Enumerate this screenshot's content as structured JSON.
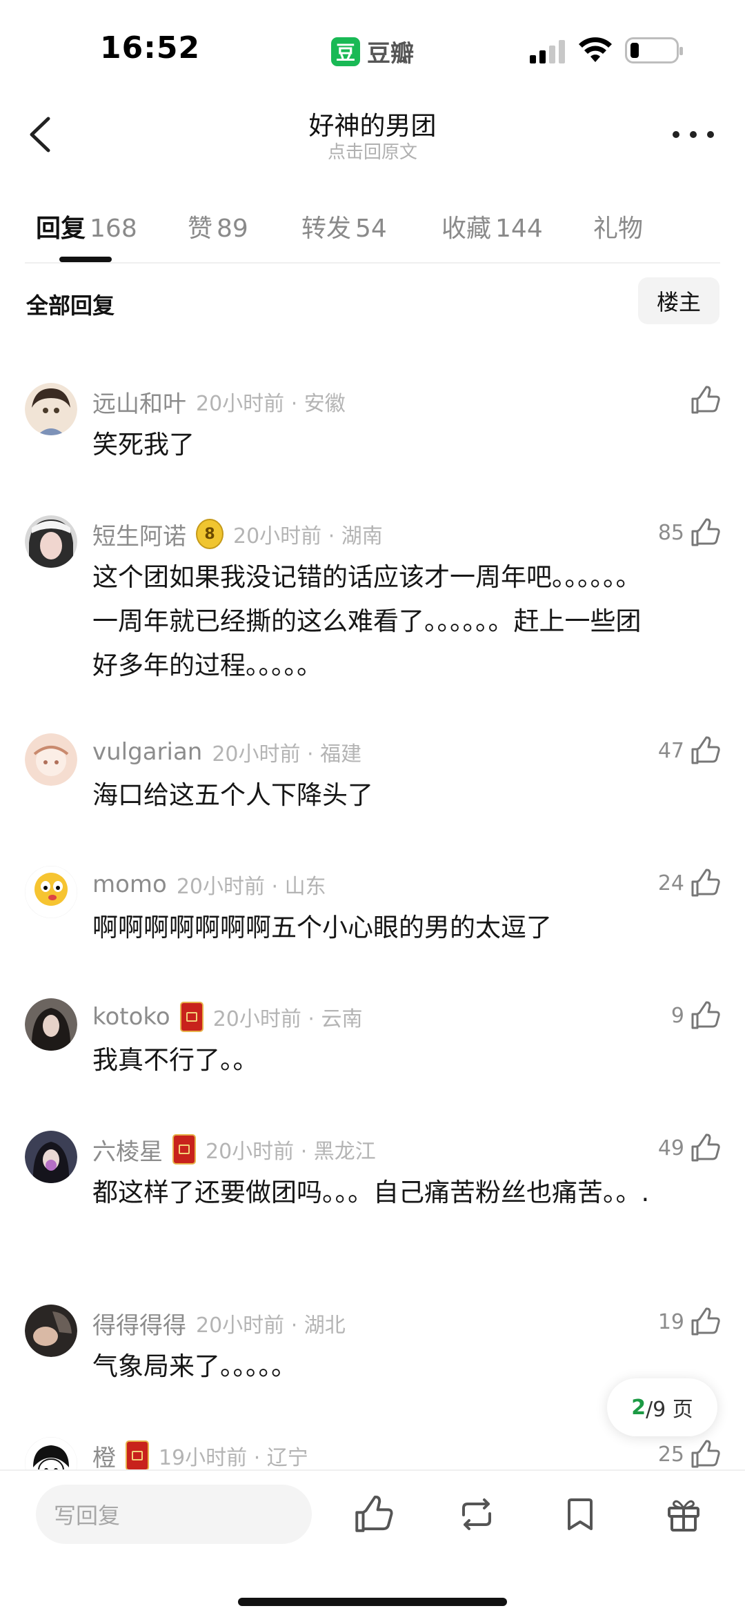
{
  "status_bar": {
    "time": "16:52",
    "app_badge": "豆",
    "app_name": "豆瓣"
  },
  "nav": {
    "title": "好神的男团",
    "subtitle": "点击回原文"
  },
  "tabs": [
    {
      "label": "回复",
      "count": "168"
    },
    {
      "label": "赞",
      "count": "89"
    },
    {
      "label": "转发",
      "count": "54"
    },
    {
      "label": "收藏",
      "count": "144"
    },
    {
      "label": "礼物",
      "count": ""
    }
  ],
  "filter": {
    "label": "全部回复",
    "owner_button": "楼主"
  },
  "comments": [
    {
      "name": "远山和叶",
      "badge": "",
      "meta": "20小时前 · 安徽",
      "body": "笑死我了",
      "likes": ""
    },
    {
      "name": "短生阿诺",
      "badge": "8",
      "meta": "20小时前 · 湖南",
      "body": "这个团如果我没记错的话应该才一周年吧。。。。。。一周年就已经撕的这么难看了。。。。。。赶上一些团好多年的过程。。。。。",
      "likes": "85"
    },
    {
      "name": "vulgarian",
      "badge": "",
      "meta": "20小时前 · 福建",
      "body": "海口给这五个人下降头了",
      "likes": "47"
    },
    {
      "name": "momo",
      "badge": "",
      "meta": "20小时前 · 山东",
      "body": "啊啊啊啊啊啊啊五个小心眼的男的太逗了",
      "likes": "24"
    },
    {
      "name": "kotoko",
      "badge": "red",
      "meta": "20小时前 · 云南",
      "body": "我真不行了。。",
      "likes": "9"
    },
    {
      "name": "六棱星",
      "badge": "red",
      "meta": "20小时前 · 黑龙江",
      "body": "都这样了还要做团吗。。。自己痛苦粉丝也痛苦。。.",
      "likes": "49"
    },
    {
      "name": "得得得得",
      "badge": "",
      "meta": "20小时前 · 湖北",
      "body": "气象局来了。。。。。",
      "likes": "19"
    },
    {
      "name": "橙",
      "badge": "red",
      "meta": "19小时前 · 辽宁",
      "body": "",
      "likes": "25"
    }
  ],
  "pagination": {
    "current": "2",
    "total": "/9 页"
  },
  "bottom_bar": {
    "reply_placeholder": "写回复",
    "icons": [
      "like-icon",
      "repost-icon",
      "bookmark-icon",
      "gift-icon"
    ]
  },
  "colors": {
    "brand": "#19b955",
    "page_current": "#1c9a44",
    "badge_red": "#c8221c"
  }
}
